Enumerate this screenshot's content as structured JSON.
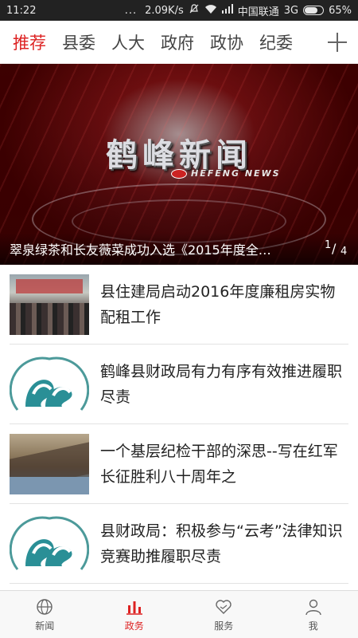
{
  "status_bar": {
    "time": "11:22",
    "dots": "...",
    "speed": "2.09K/s",
    "carrier": "中国联通",
    "network": "3G",
    "battery": "65%",
    "battery_level": 0.65
  },
  "tabs": [
    {
      "label": "推荐",
      "active": true
    },
    {
      "label": "县委",
      "active": false
    },
    {
      "label": "人大",
      "active": false
    },
    {
      "label": "政府",
      "active": false
    },
    {
      "label": "政协",
      "active": false
    },
    {
      "label": "纪委",
      "active": false
    }
  ],
  "banner": {
    "logo_title": "鹤峰新闻",
    "logo_sub": "HEFENG NEWS",
    "caption": "翠泉绿茶和长友薇菜成功入选《2015年度全…",
    "page_current": "1",
    "page_total": "4"
  },
  "news": [
    {
      "title": "县住建局启动2016年度廉租房实物配租工作",
      "thumb": "meeting-photo"
    },
    {
      "title": "鹤峰县财政局有力有序有效推进履职尽责",
      "thumb": "finance-logo"
    },
    {
      "title": " 一个基层纪检干部的深思--写在红军长征胜利八十周年之",
      "thumb": "mountain-photo"
    },
    {
      "title": "县财政局：积极参与“云考”法律知识竞赛助推履职尽责",
      "thumb": "finance-logo"
    }
  ],
  "bottom_nav": [
    {
      "label": "新闻",
      "icon": "globe-icon",
      "active": false
    },
    {
      "label": "政务",
      "icon": "bar-chart-icon",
      "active": true
    },
    {
      "label": "服务",
      "icon": "handshake-heart-icon",
      "active": false
    },
    {
      "label": "我",
      "icon": "person-icon",
      "active": false
    }
  ],
  "colors": {
    "accent": "#d22222"
  }
}
